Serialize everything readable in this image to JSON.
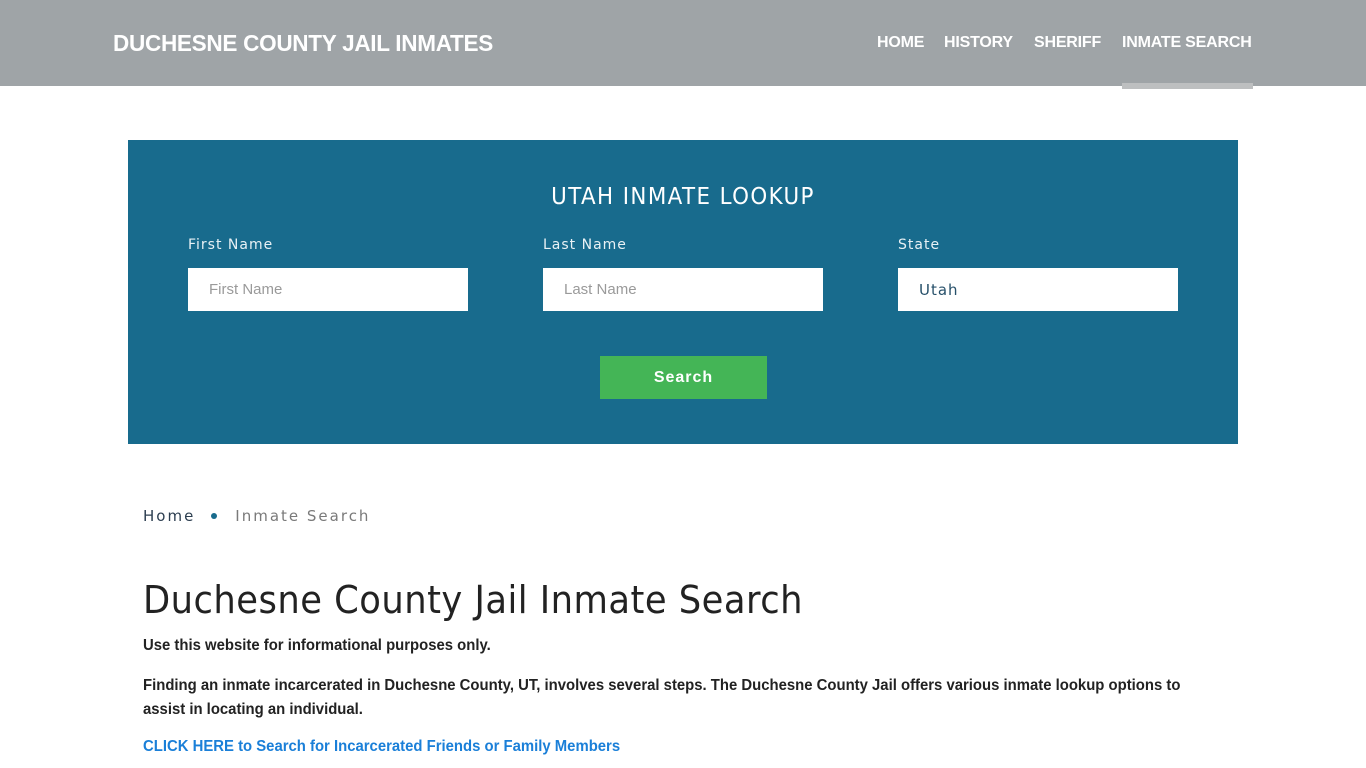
{
  "header": {
    "brand": "DUCHESNE COUNTY JAIL INMATES",
    "nav": [
      {
        "label": "HOME",
        "active": false
      },
      {
        "label": "HISTORY",
        "active": false
      },
      {
        "label": "SHERIFF",
        "active": false
      },
      {
        "label": "INMATE SEARCH",
        "active": true
      }
    ]
  },
  "search_panel": {
    "title": "UTAH INMATE LOOKUP",
    "first_name": {
      "label": "First Name",
      "placeholder": "First Name",
      "value": ""
    },
    "last_name": {
      "label": "Last Name",
      "placeholder": "Last Name",
      "value": ""
    },
    "state": {
      "label": "State",
      "value": "Utah"
    },
    "search_label": "Search",
    "colors": {
      "panel": "#186b8d",
      "button": "#44b556"
    }
  },
  "breadcrumb": {
    "home": "Home",
    "current": "Inmate Search"
  },
  "content": {
    "title": "Duchesne County Jail Inmate Search",
    "paragraph1": "Use this website for informational purposes only.",
    "paragraph2": "Finding an inmate incarcerated in Duchesne County, UT, involves several steps. The Duchesne County Jail offers various inmate lookup options to assist in locating an individual.",
    "cta_link": "CLICK HERE to Search for Incarcerated Friends or Family Members"
  }
}
